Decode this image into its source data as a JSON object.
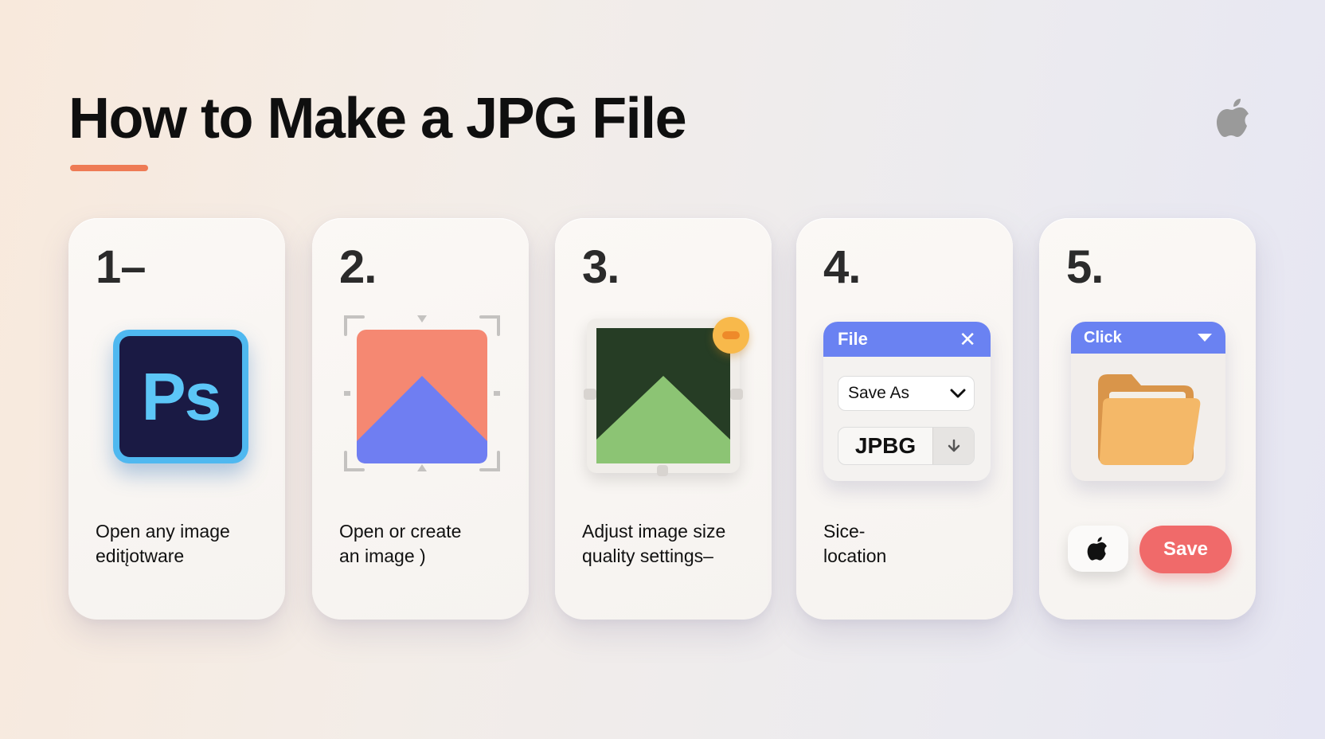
{
  "title": "How to Make a JPG File",
  "colors": {
    "accent_underline": "#ee7b55",
    "dialog_header": "#6a82f2",
    "save_button": "#f06a6a",
    "ps_icon_border": "#4fb8f0",
    "ps_icon_bg": "#1a1a44"
  },
  "steps": [
    {
      "number": "1–",
      "icon": "photoshop-icon",
      "icon_text": "Ps",
      "description": [
        "Open any image",
        "editįotware"
      ]
    },
    {
      "number": "2.",
      "icon": "image-crop-icon",
      "description": [
        "Open or create",
        "an image )"
      ]
    },
    {
      "number": "3.",
      "icon": "image-adjust-icon",
      "description": [
        "Adjust image size",
        "quality settings–"
      ]
    },
    {
      "number": "4.",
      "icon": "save-dialog-icon",
      "dialog": {
        "title": "File",
        "save_as": "Save As",
        "format": "JPBG"
      },
      "description": [
        "Sice-",
        "location"
      ]
    },
    {
      "number": "5.",
      "icon": "folder-icon",
      "panel": {
        "title": "Click"
      },
      "save_label": "Save"
    }
  ]
}
